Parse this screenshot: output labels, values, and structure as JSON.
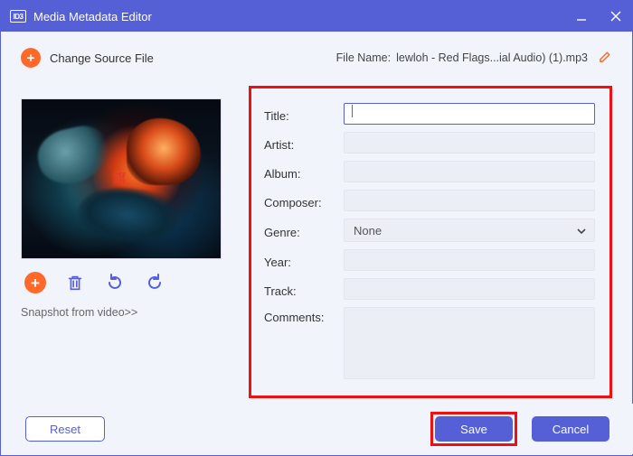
{
  "window": {
    "title": "Media Metadata Editor"
  },
  "header": {
    "change_source_label": "Change Source File",
    "file_name_label": "File Name:",
    "file_name_value": "lewloh - Red Flags...ial Audio) (1).mp3"
  },
  "artwork": {
    "snapshot_link": "Snapshot from video>>"
  },
  "form": {
    "labels": {
      "title": "Title:",
      "artist": "Artist:",
      "album": "Album:",
      "composer": "Composer:",
      "genre": "Genre:",
      "year": "Year:",
      "track": "Track:",
      "comments": "Comments:"
    },
    "values": {
      "title": "",
      "artist": "",
      "album": "",
      "composer": "",
      "genre_selected": "None",
      "year": "",
      "track": "",
      "comments": ""
    }
  },
  "footer": {
    "reset": "Reset",
    "save": "Save",
    "cancel": "Cancel"
  },
  "colors": {
    "accent": "#5560d6",
    "orange": "#ff6a2b",
    "highlight": "#e11"
  }
}
